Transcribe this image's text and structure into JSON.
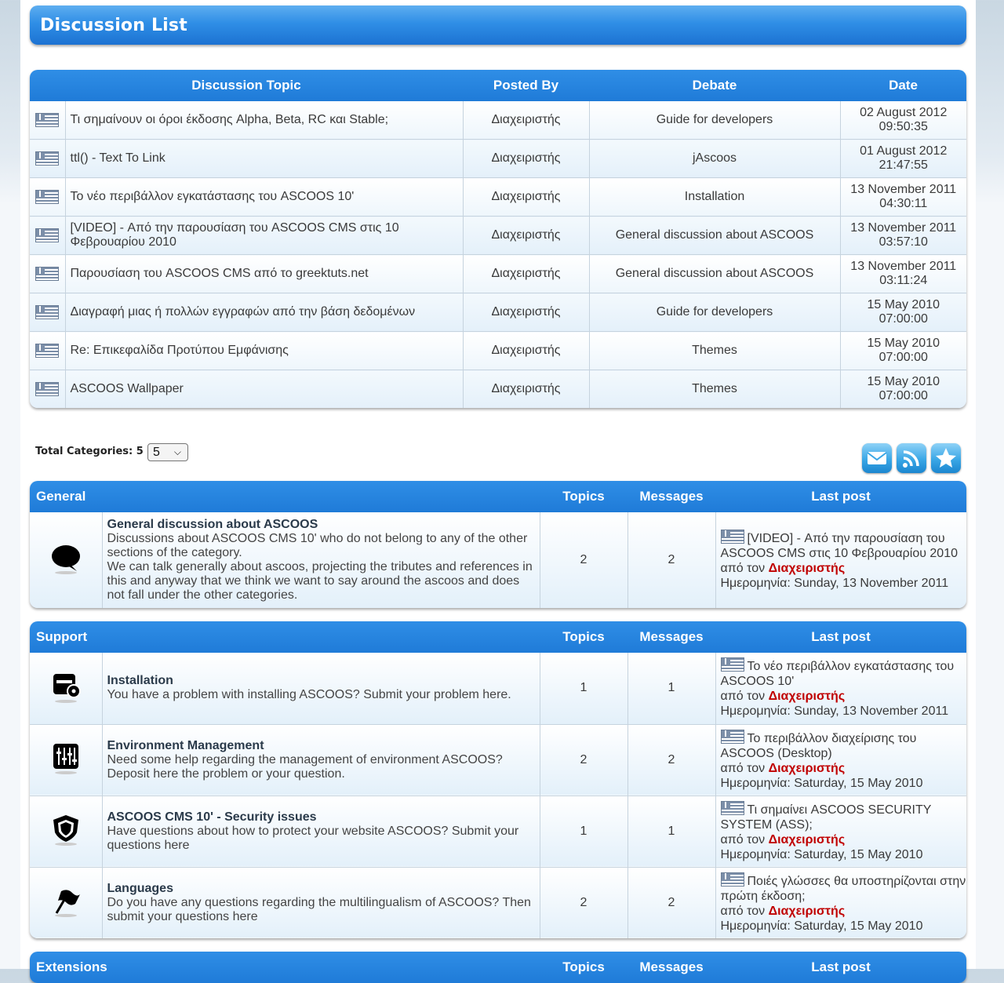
{
  "title": "Discussion List",
  "discussions": {
    "headers": {
      "topic": "Discussion Topic",
      "posted_by": "Posted By",
      "debate": "Debate",
      "date": "Date"
    },
    "rows": [
      {
        "topic": "Τι σημαίνουν οι όροι έκδοσης Alpha, Beta, RC και Stable;",
        "posted_by": "Διαχειριστής",
        "debate": "Guide for developers",
        "date": "02 August 2012",
        "time": "09:50:35"
      },
      {
        "topic": "ttl() - Text To Link",
        "posted_by": "Διαχειριστής",
        "debate": "jAscoos",
        "date": "01 August 2012",
        "time": "21:47:55"
      },
      {
        "topic": "Το νέο περιβάλλον εγκατάστασης του ASCOOS 10'",
        "posted_by": "Διαχειριστής",
        "debate": "Installation",
        "date": "13 November 2011",
        "time": "04:30:11"
      },
      {
        "topic": "[VIDEO] - Από την παρουσίαση του ASCOOS CMS στις 10 Φεβρουαρίου 2010",
        "posted_by": "Διαχειριστής",
        "debate": "General discussion about ASCOOS",
        "date": "13 November 2011",
        "time": "03:57:10"
      },
      {
        "topic": "Παρουσίαση του ASCOOS CMS από το greektuts.net",
        "posted_by": "Διαχειριστής",
        "debate": "General discussion about ASCOOS",
        "date": "13 November 2011",
        "time": "03:11:24"
      },
      {
        "topic": "Διαγραφή μιας ή πολλών εγγραφών από την βάση δεδομένων",
        "posted_by": "Διαχειριστής",
        "debate": "Guide for developers",
        "date": "15 May 2010",
        "time": "07:00:00"
      },
      {
        "topic": "Re: Επικεφαλίδα Προτύπου Εμφάνισης",
        "posted_by": "Διαχειριστής",
        "debate": "Themes",
        "date": "15 May 2010",
        "time": "07:00:00"
      },
      {
        "topic": "ASCOOS Wallpaper",
        "posted_by": "Διαχειριστής",
        "debate": "Themes",
        "date": "15 May 2010",
        "time": "07:00:00"
      }
    ]
  },
  "totals": {
    "label": "Total Categories: 5",
    "select_value": "5"
  },
  "actions": [
    {
      "icon": "mail-icon"
    },
    {
      "icon": "rss-icon"
    },
    {
      "icon": "star-icon"
    }
  ],
  "col_headers": {
    "topics": "Topics",
    "messages": "Messages",
    "last_post": "Last post"
  },
  "last_post_labels": {
    "by": "από τον ",
    "date_prefix": "Ημερομηνία: "
  },
  "categories": [
    {
      "name": "General",
      "forums": [
        {
          "icon": "speech-bubble-icon",
          "name": "General discussion about ASCOOS",
          "description": "Discussions about ASCOOS CMS 10' who do not belong to any of the other sections of the category.",
          "description2": "We can talk generally about ascoos, projecting the tributes and references in this and anyway that we think we want to say around the ascoos and does not fall under the other categories.",
          "topics": "2",
          "messages": "2",
          "last_title": "[VIDEO] - Από την παρουσίαση του ASCOOS CMS στις 10 Φεβρουαρίου 2010",
          "last_user": "Διαχειριστής",
          "last_date": "Sunday, 13 November 2011"
        }
      ]
    },
    {
      "name": "Support",
      "forums": [
        {
          "icon": "install-disk-icon",
          "name": "Installation",
          "description": "You have a problem with installing ASCOOS? Submit your problem here.",
          "topics": "1",
          "messages": "1",
          "last_title": "Το νέο περιβάλλον εγκατάστασης του ASCOOS 10'",
          "last_user": "Διαχειριστής",
          "last_date": "Sunday, 13 November 2011"
        },
        {
          "icon": "equalizer-icon",
          "name": "Environment Management",
          "description": "Need some help regarding the management of environment ASCOOS? Deposit here the problem or your question.",
          "topics": "2",
          "messages": "2",
          "last_title": "Το περιβάλλον διαχείρισης του ASCOOS (Desktop)",
          "last_user": "Διαχειριστής",
          "last_date": "Saturday, 15 May 2010"
        },
        {
          "icon": "shield-icon",
          "name": "ASCOOS CMS 10' - Security issues",
          "description": "Have questions about how to protect your website ASCOOS? Submit your questions here",
          "topics": "1",
          "messages": "1",
          "last_title": "Τι σημαίνει ASCOOS SECURITY SYSTEM (ASS);",
          "last_user": "Διαχειριστής",
          "last_date": "Saturday, 15 May 2010"
        },
        {
          "icon": "flag-icon",
          "name": "Languages",
          "description": "Do you have any questions regarding the multilingualism of ASCOOS? Then submit your questions here",
          "topics": "2",
          "messages": "2",
          "last_title": "Ποιές γλώσσες θα υποστηρίζονται στην πρώτη έκδοση;",
          "last_user": "Διαχειριστής",
          "last_date": "Saturday, 15 May 2010"
        }
      ]
    },
    {
      "name": "Extensions",
      "forums": []
    }
  ]
}
